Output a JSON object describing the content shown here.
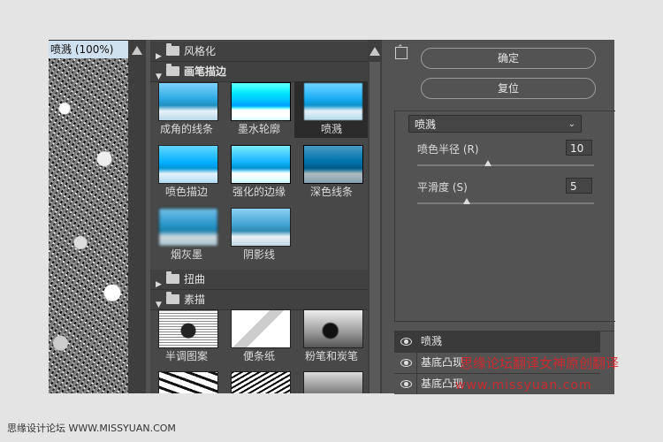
{
  "preview": {
    "title": "喷溅 (100%)"
  },
  "gallery": {
    "categories": [
      {
        "label": "风格化",
        "expanded": false
      },
      {
        "label": "画笔描边",
        "expanded": true
      },
      {
        "label": "扭曲",
        "expanded": false
      },
      {
        "label": "素描",
        "expanded": true
      }
    ],
    "brush_filters": [
      "成角的线条",
      "墨水轮廓",
      "喷溅",
      "喷色描边",
      "强化的边缘",
      "深色线条",
      "烟灰墨",
      "阴影线"
    ],
    "sketch_filters": [
      "半调图案",
      "便条纸",
      "粉笔和炭笔"
    ],
    "selected": "喷溅"
  },
  "buttons": {
    "ok": "确定",
    "reset": "复位"
  },
  "filter_select": {
    "value": "喷溅"
  },
  "params": [
    {
      "label": "喷色半径 (R)",
      "value": "10",
      "level_fraction": 0.4
    },
    {
      "label": "平滑度 (S)",
      "value": "5",
      "level_fraction": 0.28
    }
  ],
  "layers": [
    "喷溅",
    "基底凸现",
    "基底凸现"
  ],
  "watermark": {
    "line1": "思缘论坛翻译女神原创翻译",
    "line2": "www.missyuan.com"
  },
  "footer": "思缘设计论坛 WWW.MISSYUAN.COM"
}
